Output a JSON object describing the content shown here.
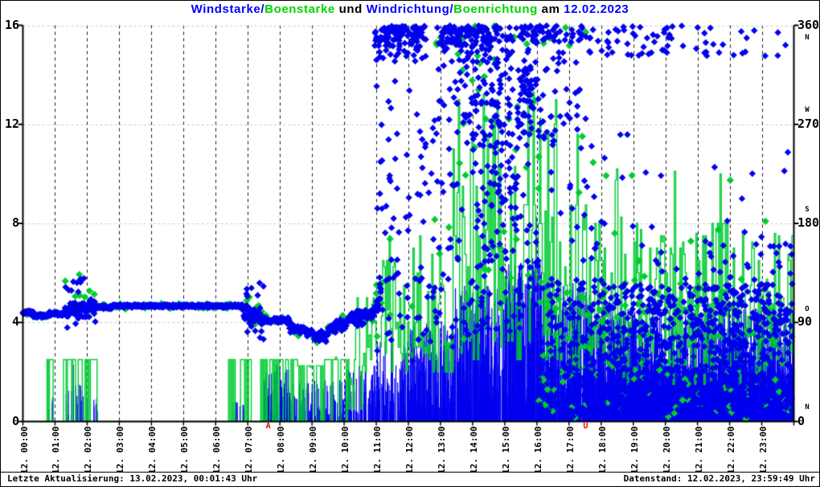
{
  "page": {
    "footer": {
      "left": "Letzte Aktualisierung: 13.02.2023, 00:01:43 Uhr",
      "right": "Datenstand: 12.02.2023, 23:59:49 Uhr"
    }
  },
  "colors": {
    "blue": "#0000ee",
    "green": "#00cc33",
    "title_blue": "#0000ff",
    "title_green": "#00d500",
    "black": "#000000",
    "red": "#ee0000",
    "grid_gray": "#c8c8c8",
    "grid_dark": "#141414",
    "axis": "#000000"
  },
  "chart_data": {
    "type": "mixed",
    "note": "Meteogram: blue diamonds = wind direction (right axis, deg), green diamonds = gust direction, blue vertical bars = wind strength (left axis), green step line = gust strength. Dense storm scatter after 11:00 is encoded as sampled regions.",
    "title_parts": [
      {
        "text": "Windstarke/",
        "color": "#0000ff"
      },
      {
        "text": "Boenstarke",
        "color": "#00d500"
      },
      {
        "text": " und ",
        "color": "#000000"
      },
      {
        "text": "Windrichtung/",
        "color": "#0000ff"
      },
      {
        "text": "Boenrichtung",
        "color": "#00d500"
      },
      {
        "text": " am ",
        "color": "#000000"
      },
      {
        "text": "12.02.2023",
        "color": "#0000ff"
      }
    ],
    "left_axis": {
      "min": 0,
      "max": 16,
      "ticks": [
        0,
        4,
        8,
        12,
        16
      ]
    },
    "right_axis": {
      "min": 0,
      "max": 360,
      "ticks": [
        0,
        90,
        180,
        270,
        360
      ],
      "compass": [
        {
          "deg": 348,
          "letter": "N"
        },
        {
          "deg": 282,
          "letter": "W"
        },
        {
          "deg": 192,
          "letter": "S"
        },
        {
          "deg": 101,
          "letter": "O"
        },
        {
          "deg": 12,
          "letter": "N"
        }
      ]
    },
    "x_axis": {
      "min_hour": 0,
      "max_hour": 24,
      "tick_labels": [
        "12. 00:00",
        "12. 01:00",
        "12. 02:00",
        "12. 03:00",
        "12. 04:00",
        "12. 05:00",
        "12. 06:00",
        "12. 07:00",
        "12. 08:00",
        "12. 09:00",
        "12. 10:00",
        "12. 11:00",
        "12. 12:00",
        "12. 13:00",
        "12. 14:00",
        "12. 15:00",
        "12. 16:00",
        "12. 17:00",
        "12. 18:00",
        "12. 19:00",
        "12. 20:00",
        "12. 21:00",
        "12. 22:00",
        "12. 23:00"
      ]
    },
    "grid": {
      "h_lines_at": [
        4,
        8,
        12,
        16
      ],
      "v_lines_every_hour": true
    },
    "sun_markers": [
      {
        "hour": 7.66,
        "glyph": "A"
      },
      {
        "hour": 17.54,
        "glyph": "U"
      }
    ],
    "render_seed": 20230212,
    "wind_direction_track": {
      "points_per_hour": 68,
      "segments": [
        [
          0.0,
          0.33,
          99,
          99,
          2
        ],
        [
          0.33,
          0.8,
          96,
          96,
          2
        ],
        [
          0.8,
          1.3,
          98,
          98,
          2
        ],
        [
          1.3,
          2.25,
          100,
          103,
          9
        ],
        [
          2.25,
          2.8,
          104,
          104,
          2
        ],
        [
          2.8,
          6.85,
          105,
          105,
          1.6
        ],
        [
          6.85,
          7.45,
          99,
          92,
          11
        ],
        [
          7.45,
          8.3,
          92,
          92,
          3
        ],
        [
          8.3,
          9.1,
          86,
          79,
          5
        ],
        [
          9.1,
          9.45,
          77,
          77,
          6
        ],
        [
          9.45,
          10.1,
          82,
          90,
          7
        ],
        [
          10.1,
          10.95,
          92,
          98,
          8
        ],
        [
          10.95,
          11.15,
          100,
          115,
          15
        ]
      ]
    },
    "direction_scatter_blue": [
      [
        1.3,
        2.3,
        85,
        132,
        22
      ],
      [
        6.9,
        7.6,
        72,
        126,
        18
      ],
      [
        10.95,
        12.6,
        330,
        360,
        60
      ],
      [
        10.95,
        12.5,
        346,
        360,
        55
      ],
      [
        11.0,
        13.6,
        140,
        330,
        55
      ],
      [
        11.0,
        14.0,
        55,
        140,
        55
      ],
      [
        12.9,
        14.6,
        335,
        360,
        70
      ],
      [
        13.0,
        17.55,
        344,
        360,
        130
      ],
      [
        13.5,
        15.85,
        250,
        342,
        140
      ],
      [
        14.0,
        15.6,
        185,
        250,
        40
      ],
      [
        15.6,
        17.35,
        252,
        330,
        55
      ],
      [
        14.0,
        16.05,
        80,
        185,
        65
      ],
      [
        16.05,
        18.05,
        2,
        130,
        160
      ],
      [
        11.0,
        18.0,
        140,
        345,
        70
      ],
      [
        17.6,
        20.0,
        332,
        360,
        38
      ],
      [
        20.0,
        23.95,
        332,
        360,
        30
      ],
      [
        18.05,
        21.0,
        2,
        125,
        330
      ],
      [
        21.0,
        23.95,
        2,
        125,
        400
      ],
      [
        17.0,
        23.95,
        128,
        262,
        40
      ],
      [
        21.3,
        23.95,
        125,
        165,
        25
      ]
    ],
    "direction_scatter_green": [
      [
        1.3,
        2.3,
        92,
        135,
        12
      ],
      [
        6.9,
        7.6,
        80,
        122,
        7
      ],
      [
        10.95,
        17.55,
        340,
        360,
        22
      ],
      [
        13.5,
        16.1,
        200,
        342,
        22
      ],
      [
        11.0,
        16.0,
        60,
        190,
        22
      ],
      [
        16.05,
        23.95,
        2,
        130,
        150
      ],
      [
        17.0,
        23.95,
        130,
        260,
        12
      ]
    ],
    "wind_speed_bars": [
      [
        0.78,
        0.95,
        0.3,
        1.6,
        30
      ],
      [
        1.3,
        2.35,
        0.2,
        1.5,
        25
      ],
      [
        1.55,
        1.7,
        0.5,
        2.6,
        20
      ],
      [
        6.45,
        7.05,
        0.2,
        1.0,
        20
      ],
      [
        7.5,
        8.45,
        0.3,
        2.3,
        90
      ],
      [
        8.45,
        10.05,
        0.2,
        1.7,
        60
      ],
      [
        10.05,
        10.95,
        0.3,
        2.3,
        70
      ],
      [
        10.95,
        12.05,
        0.3,
        3.3,
        90
      ],
      [
        12.05,
        13.45,
        0.4,
        4.2,
        110
      ],
      [
        13.45,
        15.05,
        0.5,
        5.6,
        150
      ],
      [
        15.05,
        16.25,
        0.5,
        6.6,
        160
      ],
      [
        15.85,
        16.15,
        5.0,
        8.6,
        15
      ],
      [
        16.25,
        17.65,
        0.5,
        5.6,
        150
      ],
      [
        17.65,
        24.0,
        0.3,
        2.2,
        260
      ],
      [
        17.65,
        19.05,
        0.5,
        4.7,
        140
      ],
      [
        19.05,
        21.05,
        0.5,
        4.3,
        140
      ],
      [
        21.05,
        22.35,
        0.5,
        5.0,
        140
      ],
      [
        22.35,
        23.98,
        0.5,
        4.6,
        140
      ]
    ],
    "gust_step_blocks": [
      [
        0.0,
        0.75,
        0,
        0,
        0
      ],
      [
        0.75,
        0.98,
        0,
        2.5,
        0.5
      ],
      [
        0.98,
        1.22,
        0,
        0,
        0
      ],
      [
        1.22,
        2.35,
        0,
        2.5,
        0.5
      ],
      [
        2.35,
        6.4,
        0,
        0,
        0
      ],
      [
        6.4,
        7.15,
        0,
        2.5,
        0.45
      ],
      [
        7.15,
        7.4,
        0,
        0,
        0
      ],
      [
        7.4,
        8.55,
        0,
        2.5,
        0.65
      ],
      [
        8.55,
        9.35,
        0,
        2.2,
        0.55
      ],
      [
        9.35,
        10.15,
        0,
        2.6,
        0.6
      ],
      [
        10.15,
        10.65,
        0.5,
        5.0,
        0.75
      ],
      [
        10.65,
        11.2,
        2.5,
        5.0,
        0.85
      ],
      [
        11.2,
        11.6,
        2.5,
        7.5,
        0.85
      ],
      [
        11.6,
        12.1,
        2.5,
        5.5,
        0.85
      ],
      [
        12.1,
        12.6,
        2.5,
        7.5,
        0.9
      ],
      [
        12.6,
        13.35,
        2.5,
        7.0,
        0.9
      ],
      [
        13.35,
        13.8,
        2.5,
        13.0,
        0.92
      ],
      [
        13.8,
        14.15,
        3.0,
        11.5,
        0.92
      ],
      [
        14.15,
        14.5,
        3.0,
        13.2,
        0.92
      ],
      [
        14.5,
        15.05,
        3.0,
        13.0,
        0.92
      ],
      [
        15.05,
        15.55,
        3.0,
        10.3,
        0.92
      ],
      [
        15.55,
        16.25,
        3.0,
        13.3,
        0.92
      ],
      [
        16.25,
        16.95,
        3.0,
        13.0,
        0.92
      ],
      [
        16.95,
        17.55,
        2.5,
        11.6,
        0.92
      ],
      [
        17.55,
        18.35,
        2.5,
        8.0,
        0.9
      ],
      [
        18.35,
        18.65,
        2.5,
        10.2,
        0.9
      ],
      [
        18.65,
        19.55,
        2.0,
        8.0,
        0.88
      ],
      [
        19.55,
        20.15,
        2.0,
        7.5,
        0.88
      ],
      [
        20.15,
        20.45,
        2.0,
        10.1,
        0.88
      ],
      [
        20.45,
        21.45,
        2.0,
        7.6,
        0.88
      ],
      [
        21.45,
        21.95,
        2.0,
        10.0,
        0.88
      ],
      [
        21.95,
        22.85,
        2.0,
        7.7,
        0.88
      ],
      [
        22.85,
        23.98,
        2.0,
        7.6,
        0.88
      ]
    ]
  }
}
